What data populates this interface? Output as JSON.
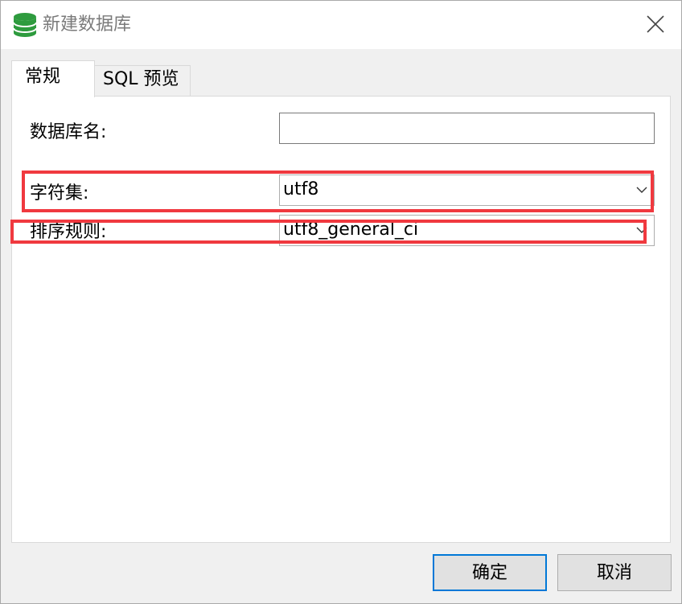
{
  "window": {
    "title": "新建数据库",
    "icon": "database-icon"
  },
  "tabs": [
    {
      "label": "常规",
      "active": true
    },
    {
      "label": "SQL 预览",
      "active": false
    }
  ],
  "form": {
    "database_name": {
      "label": "数据库名:",
      "value": ""
    },
    "charset": {
      "label": "字符集:",
      "value": "utf8"
    },
    "collation": {
      "label": "排序规则:",
      "value": "utf8_general_ci"
    }
  },
  "buttons": {
    "ok": "确定",
    "cancel": "取消"
  },
  "colors": {
    "highlight": "#f0393f",
    "icon_green": "#2e9b3e",
    "focus_border": "#0078d7"
  }
}
